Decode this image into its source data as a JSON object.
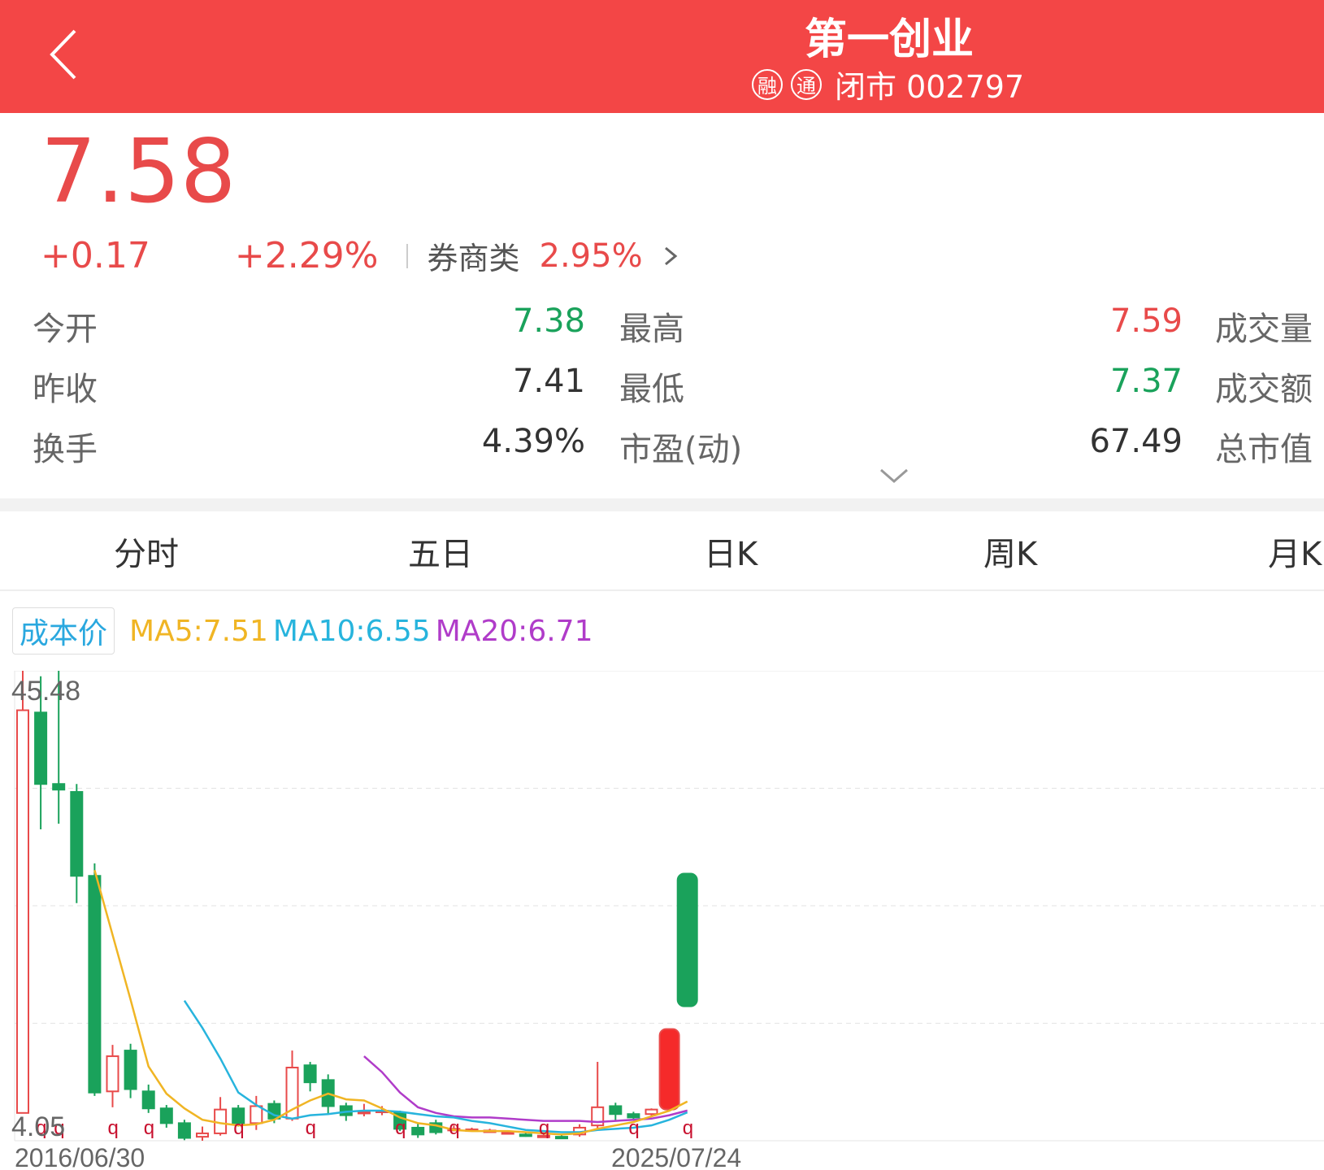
{
  "header": {
    "title": "第一创业",
    "badge_rong": "融",
    "badge_tong": "通",
    "status_code": "闭市 002797"
  },
  "quote": {
    "price": "7.58",
    "change": "+0.17",
    "change_pct": "+2.29%",
    "sector_name": "券商类",
    "sector_pct": "2.95%"
  },
  "stats": {
    "open_label": "今开",
    "open": "7.38",
    "prev_label": "昨收",
    "prev": "7.41",
    "turnover_label": "换手",
    "turnover": "4.39%",
    "high_label": "最高",
    "high": "7.59",
    "low_label": "最低",
    "low": "7.37",
    "pe_label": "市盈(动)",
    "pe": "67.49",
    "vol_label": "成交量",
    "amount_label": "成交额",
    "mktcap_label": "总市值"
  },
  "tabs": [
    "分时",
    "五日",
    "日K",
    "周K",
    "月K"
  ],
  "legend": {
    "cost": "成本价",
    "ma5": "MA5:7.51",
    "ma10": "MA10:6.55",
    "ma20": "MA20:6.71"
  },
  "colors": {
    "brand_red": "#f34646",
    "up": "#e84a4a",
    "down": "#1aa25b",
    "ma5": "#f0b524",
    "ma10": "#27b4dd",
    "ma20": "#b03cc9"
  },
  "chart_data": {
    "type": "candlestick",
    "y_max_label": "45.48",
    "y_min_label": "4.05",
    "x_start_label": "2016/06/30",
    "x_end_label": "2025/07/24",
    "ylim": [
      4.05,
      45.48
    ],
    "candles": [
      {
        "o": 6.5,
        "c": 42.0,
        "h": 45.48,
        "l": 6.5
      },
      {
        "o": 41.8,
        "c": 35.5,
        "h": 45.0,
        "l": 31.5
      },
      {
        "o": 35.5,
        "c": 35.0,
        "h": 45.48,
        "l": 32.0
      },
      {
        "o": 34.8,
        "c": 27.4,
        "h": 35.5,
        "l": 25.0
      },
      {
        "o": 27.4,
        "c": 8.3,
        "h": 28.5,
        "l": 8.0
      },
      {
        "o": 8.4,
        "c": 11.5,
        "h": 12.5,
        "l": 7.0
      },
      {
        "o": 12.0,
        "c": 8.6,
        "h": 12.6,
        "l": 7.8
      },
      {
        "o": 8.4,
        "c": 6.9,
        "h": 9.0,
        "l": 6.5
      },
      {
        "o": 6.9,
        "c": 5.6,
        "h": 7.2,
        "l": 5.2
      },
      {
        "o": 5.6,
        "c": 4.3,
        "h": 5.9,
        "l": 4.1
      },
      {
        "o": 4.4,
        "c": 4.7,
        "h": 5.3,
        "l": 4.05
      },
      {
        "o": 4.7,
        "c": 6.8,
        "h": 7.9,
        "l": 4.5
      },
      {
        "o": 6.9,
        "c": 5.6,
        "h": 7.2,
        "l": 5.3
      },
      {
        "o": 5.6,
        "c": 7.1,
        "h": 8.0,
        "l": 5.0
      },
      {
        "o": 7.3,
        "c": 6.0,
        "h": 7.6,
        "l": 5.6
      },
      {
        "o": 6.0,
        "c": 10.5,
        "h": 12.0,
        "l": 5.8
      },
      {
        "o": 10.7,
        "c": 9.2,
        "h": 11.0,
        "l": 8.4
      },
      {
        "o": 9.4,
        "c": 7.1,
        "h": 9.9,
        "l": 6.4
      },
      {
        "o": 7.1,
        "c": 6.3,
        "h": 7.4,
        "l": 5.8
      },
      {
        "o": 6.5,
        "c": 6.6,
        "h": 7.3,
        "l": 6.2
      },
      {
        "o": 6.6,
        "c": 6.7,
        "h": 7.1,
        "l": 6.3
      },
      {
        "o": 6.5,
        "c": 5.1,
        "h": 6.7,
        "l": 4.9
      },
      {
        "o": 5.2,
        "c": 4.6,
        "h": 5.6,
        "l": 4.3
      },
      {
        "o": 5.6,
        "c": 4.8,
        "h": 5.9,
        "l": 4.6
      },
      {
        "o": 5.0,
        "c": 5.1,
        "h": 5.4,
        "l": 4.9
      },
      {
        "o": 5.0,
        "c": 5.05,
        "h": 5.2,
        "l": 4.9
      },
      {
        "o": 4.9,
        "c": 4.95,
        "h": 5.1,
        "l": 4.8
      },
      {
        "o": 4.7,
        "c": 4.8,
        "h": 4.95,
        "l": 4.6
      },
      {
        "o": 4.6,
        "c": 4.5,
        "h": 4.8,
        "l": 4.4
      },
      {
        "o": 4.5,
        "c": 4.5,
        "h": 4.7,
        "l": 4.3
      },
      {
        "o": 4.4,
        "c": 4.3,
        "h": 4.6,
        "l": 4.2
      },
      {
        "o": 4.6,
        "c": 5.2,
        "h": 5.5,
        "l": 4.4
      },
      {
        "o": 5.4,
        "c": 7.0,
        "h": 11.0,
        "l": 5.0
      },
      {
        "o": 7.1,
        "c": 6.4,
        "h": 7.4,
        "l": 5.8
      },
      {
        "o": 6.4,
        "c": 6.1,
        "h": 6.6,
        "l": 5.9
      },
      {
        "o": 6.4,
        "c": 6.8,
        "h": 6.9,
        "l": 6.2
      },
      {
        "o": 6.8,
        "c": 13.9,
        "h": 13.9,
        "l": 6.8
      },
      {
        "o": 27.6,
        "c": 15.9,
        "h": 27.6,
        "l": 15.9
      }
    ],
    "ma5": [
      null,
      null,
      null,
      null,
      27.9,
      22.2,
      16.5,
      10.6,
      8.2,
      6.9,
      5.9,
      5.6,
      5.4,
      5.5,
      5.9,
      6.8,
      7.6,
      8.2,
      7.7,
      7.6,
      6.9,
      6.1,
      5.6,
      5.4,
      5.0,
      4.9,
      4.9,
      4.9,
      4.8,
      4.7,
      4.6,
      4.7,
      5.1,
      5.4,
      5.7,
      6.2,
      6.7,
      7.51
    ],
    "ma10": [
      null,
      null,
      null,
      null,
      null,
      null,
      null,
      null,
      null,
      16.4,
      14.0,
      11.3,
      8.3,
      7.2,
      6.3,
      6.0,
      6.3,
      6.4,
      6.6,
      6.7,
      6.7,
      6.6,
      6.4,
      6.2,
      6.1,
      5.8,
      5.6,
      5.3,
      5.0,
      4.9,
      4.8,
      4.8,
      5.0,
      5.1,
      5.2,
      5.4,
      5.9,
      6.55
    ],
    "ma20": [
      null,
      null,
      null,
      null,
      null,
      null,
      null,
      null,
      null,
      null,
      null,
      null,
      null,
      null,
      null,
      null,
      null,
      null,
      null,
      11.5,
      10.1,
      8.3,
      7.0,
      6.5,
      6.2,
      6.1,
      6.1,
      6.0,
      5.9,
      5.8,
      5.8,
      5.8,
      5.7,
      5.8,
      5.9,
      6.0,
      6.3,
      6.71
    ],
    "markers_below": [
      1,
      2,
      5,
      7,
      12,
      16,
      21,
      24,
      29,
      34,
      37
    ]
  }
}
